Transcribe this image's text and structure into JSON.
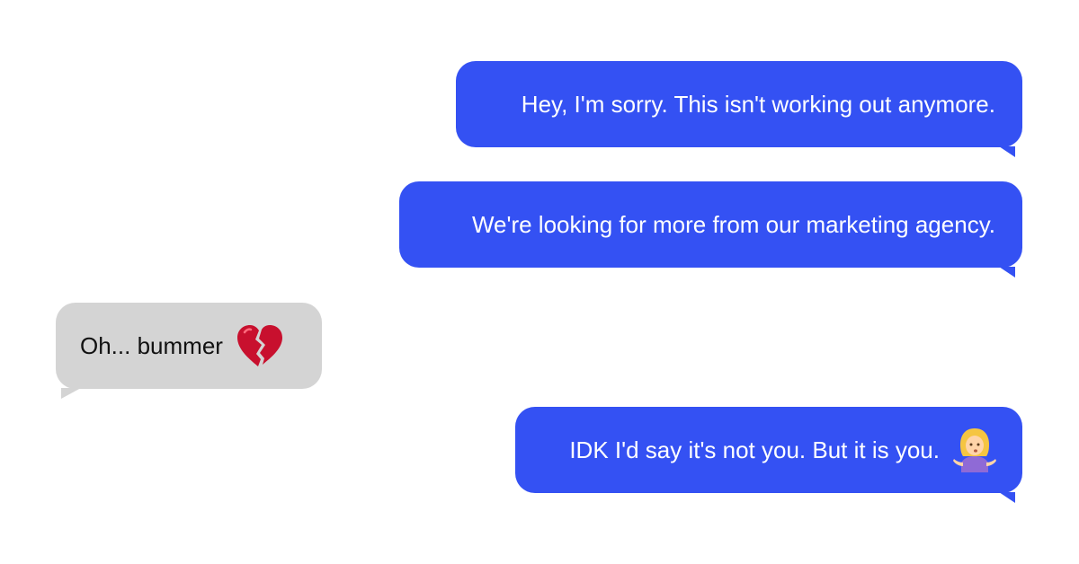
{
  "conversation": {
    "messages": [
      {
        "sender": "self",
        "text": "Hey, I'm sorry. This isn't working out anymore."
      },
      {
        "sender": "self",
        "text": "We're looking for more from our marketing agency."
      },
      {
        "sender": "other",
        "text": "Oh...  bummer",
        "emoji": "broken-heart-icon"
      },
      {
        "sender": "self",
        "text": "IDK I'd say it's not you. But it is you.",
        "emoji": "person-shrugging-icon"
      }
    ]
  },
  "colors": {
    "sent_bubble": "#3451f3",
    "received_bubble": "#d4d4d4",
    "background": "#ffffff"
  }
}
